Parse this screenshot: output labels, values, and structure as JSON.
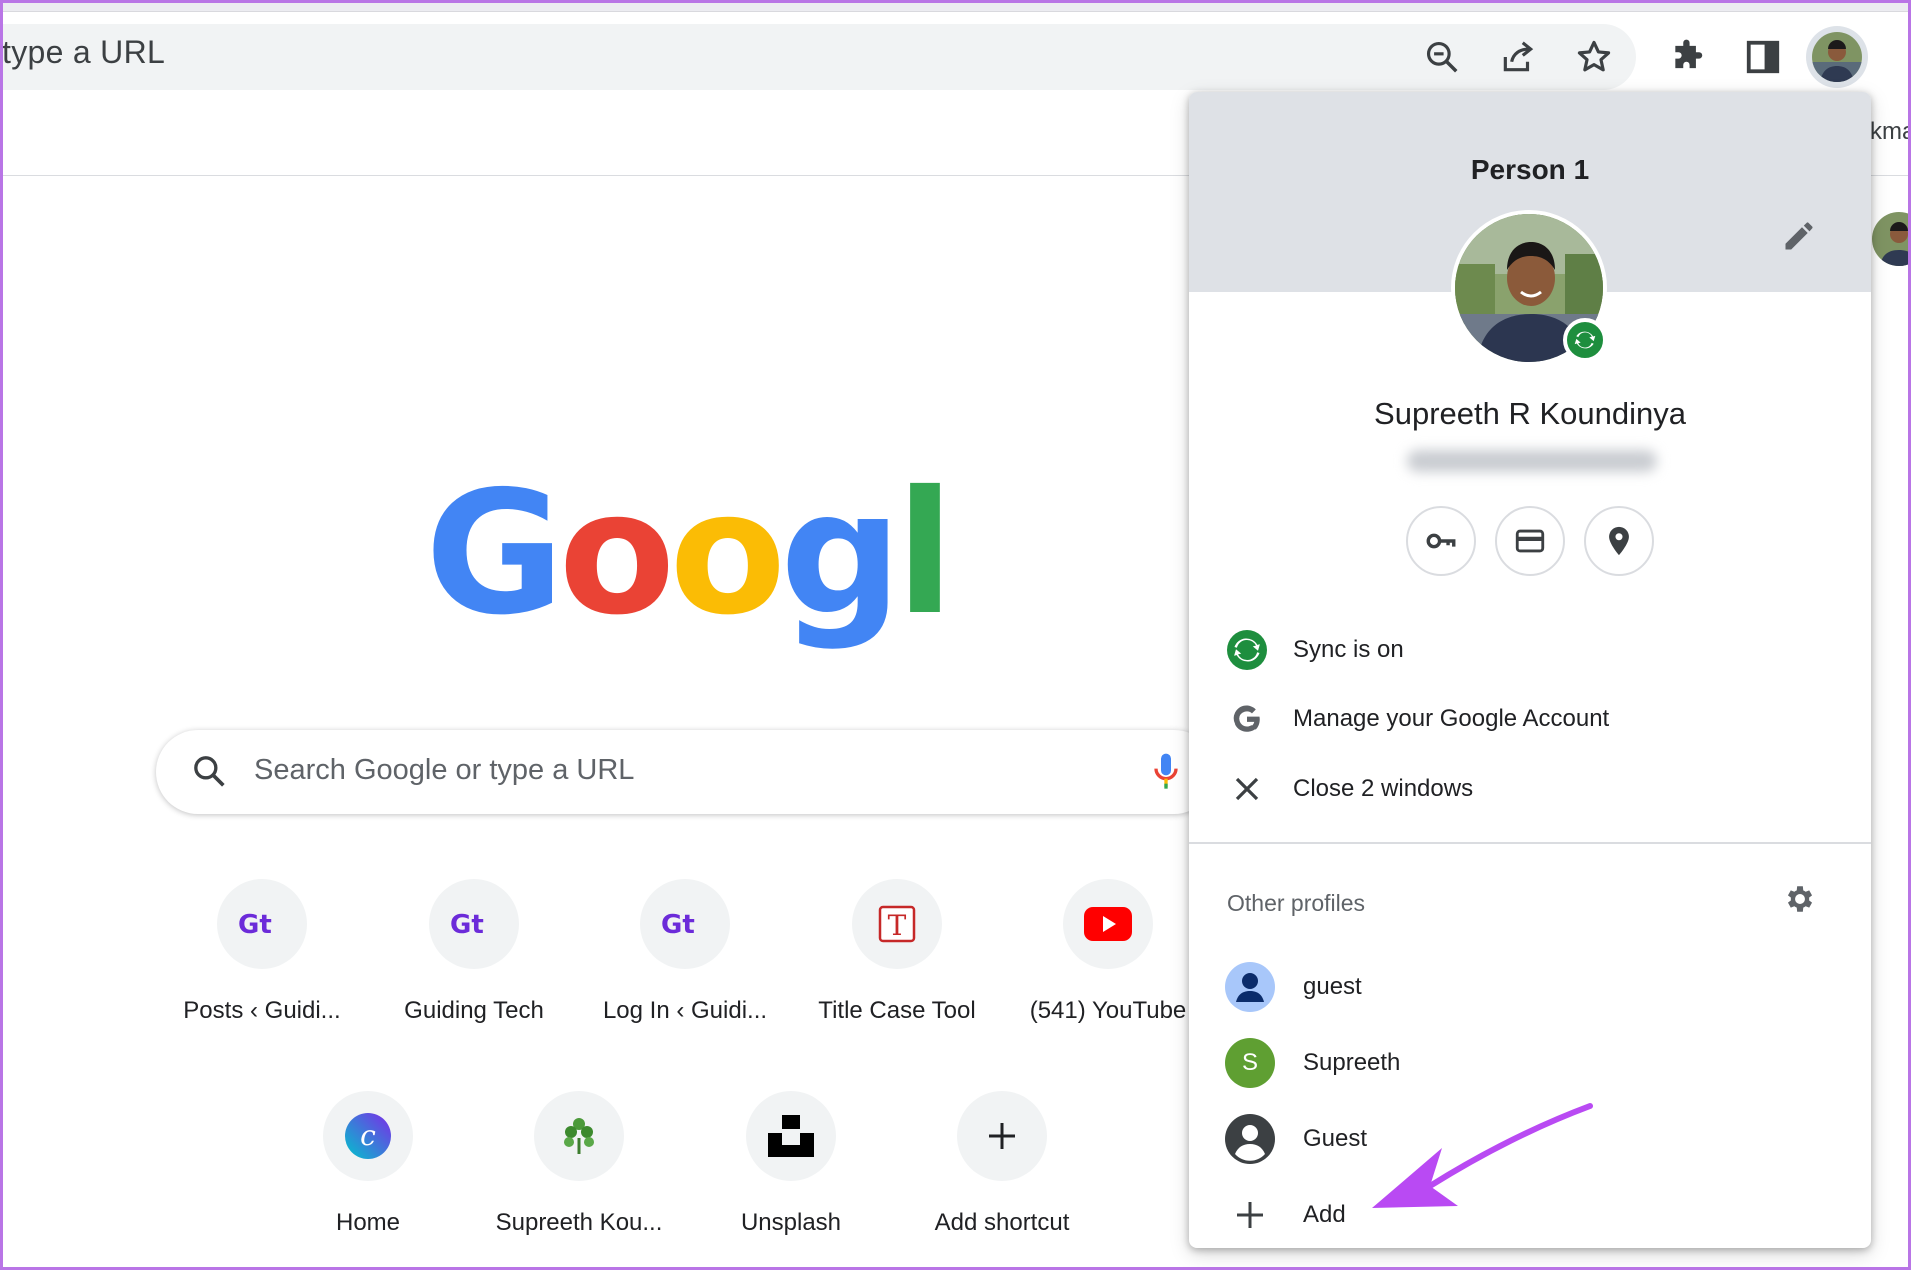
{
  "omnibox": {
    "text": "type a URL"
  },
  "toolbar": {
    "zoom_icon": "zoom-out-icon",
    "share_icon": "share-icon",
    "bookmark_icon": "star-icon",
    "extensions_icon": "puzzle-icon",
    "side_panel_icon": "side-panel-icon"
  },
  "bookmarks_bar": {
    "fragment": "kma"
  },
  "ntp": {
    "search_placeholder": "Search Google or type a URL",
    "logo_text": "Google",
    "shortcuts_row1": [
      {
        "label": "Posts ‹ Guidi...",
        "icon": "guiding-tech-icon"
      },
      {
        "label": "Guiding Tech",
        "icon": "guiding-tech-icon"
      },
      {
        "label": "Log In ‹ Guidi...",
        "icon": "guiding-tech-icon"
      },
      {
        "label": "Title Case Tool",
        "icon": "title-case-icon"
      },
      {
        "label": "(541) YouTube",
        "icon": "youtube-icon"
      }
    ],
    "shortcuts_row2": [
      {
        "label": "Home",
        "icon": "canva-icon"
      },
      {
        "label": "Supreeth Kou...",
        "icon": "plant-icon"
      },
      {
        "label": "Unsplash",
        "icon": "unsplash-icon"
      },
      {
        "label": "Add shortcut",
        "icon": "plus-icon"
      }
    ]
  },
  "profile_menu": {
    "header_title": "Person 1",
    "name": "Supreeth R Koundinya",
    "rows": [
      {
        "label": "Sync is on",
        "icon": "sync-icon"
      },
      {
        "label": "Manage your Google Account",
        "icon": "google-g-icon"
      },
      {
        "label": "Close 2 windows",
        "icon": "close-icon"
      }
    ],
    "other_profiles_label": "Other profiles",
    "profiles": [
      {
        "label": "guest",
        "icon": "person-icon"
      },
      {
        "label": "Supreeth",
        "initial": "S"
      },
      {
        "label": "Guest",
        "icon": "account-circle-icon"
      }
    ],
    "add_label": "Add"
  },
  "colors": {
    "frame_accent": "#b975e6",
    "arrow": "#b94af3",
    "sync_green": "#1e8e3e",
    "google_blue": "#4285F4",
    "google_red": "#EA4335",
    "google_yellow": "#FBBC05",
    "google_green": "#34A853",
    "youtube_red": "#FF0000",
    "profile_s_green": "#5f9f32"
  }
}
